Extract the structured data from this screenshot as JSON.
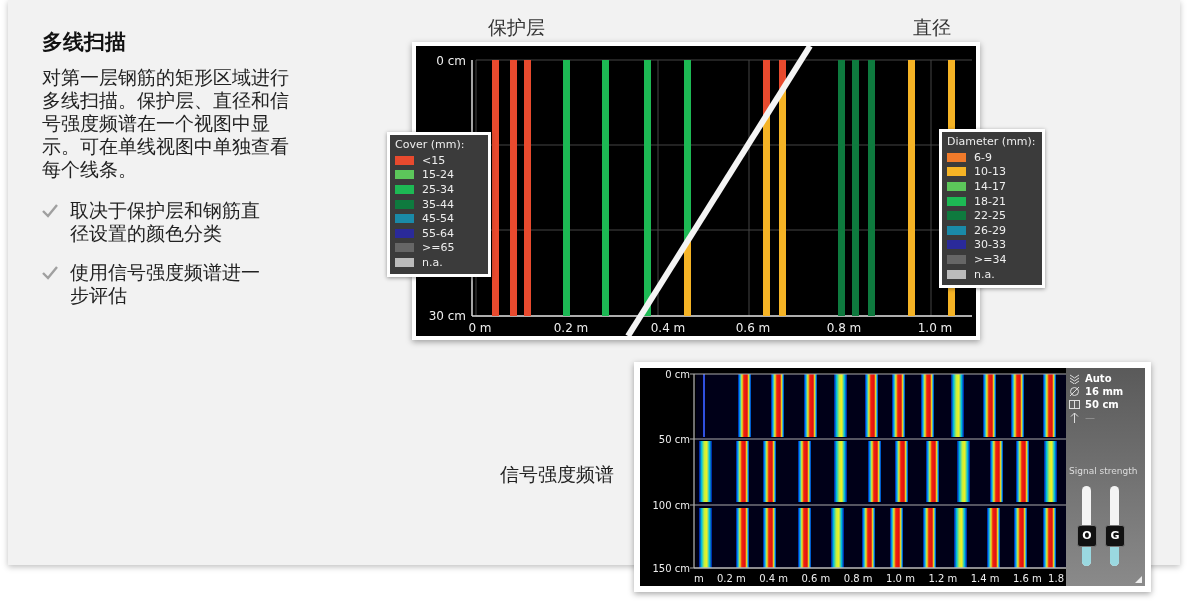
{
  "heading": "多线扫描",
  "description": "对第一层钢筋的矩形区域进行多线扫描。保护层、直径和信号强度频谱在一个视图中显示。可在单线视图中单独查看每个线条。",
  "features": [
    "取决于保护层和钢筋直径设置的颜色分类",
    "使用信号强度频谱进一步评估"
  ],
  "scan_view": {
    "left_label": "保护层",
    "right_label": "直径",
    "y_ticks": [
      "0 cm",
      "30 cm"
    ],
    "x_ticks": [
      "0 m",
      "0.2 m",
      "0.4 m",
      "0.6 m",
      "0.8 m",
      "1.0 m"
    ],
    "cover_legend": {
      "title": "Cover (mm):",
      "items": [
        {
          "label": "<15",
          "color": "#e84a2e"
        },
        {
          "label": "15-24",
          "color": "#5cc65a"
        },
        {
          "label": "25-34",
          "color": "#1db954"
        },
        {
          "label": "35-44",
          "color": "#0e7a3e"
        },
        {
          "label": "45-54",
          "color": "#1a8aa8"
        },
        {
          "label": "55-64",
          "color": "#2a2a9a"
        },
        {
          "label": ">=65",
          "color": "#666666"
        },
        {
          "label": "n.a.",
          "color": "#bbbbbb"
        }
      ]
    },
    "diameter_legend": {
      "title": "Diameter (mm):",
      "items": [
        {
          "label": "6-9",
          "color": "#f07a2a"
        },
        {
          "label": "10-13",
          "color": "#f5b325"
        },
        {
          "label": "14-17",
          "color": "#5cc65a"
        },
        {
          "label": "18-21",
          "color": "#1db954"
        },
        {
          "label": "22-25",
          "color": "#0e7a3e"
        },
        {
          "label": "26-29",
          "color": "#1a8aa8"
        },
        {
          "label": "30-33",
          "color": "#2a2a9a"
        },
        {
          "label": ">=34",
          "color": "#666666"
        },
        {
          "label": "n.a.",
          "color": "#bbbbbb"
        }
      ]
    }
  },
  "spectrum_view": {
    "label": "信号强度频谱",
    "y_ticks": [
      "0 cm",
      "50 cm",
      "100 cm",
      "150 cm"
    ],
    "x_ticks": [
      "m",
      "0.2 m",
      "0.4 m",
      "0.6 m",
      "0.8 m",
      "1.0 m",
      "1.2 m",
      "1.4 m",
      "1.6 m",
      "1.8"
    ],
    "settings": [
      {
        "kind": "depth",
        "value": "Auto"
      },
      {
        "kind": "diameter",
        "value": "16 mm"
      },
      {
        "kind": "spacing",
        "value": "50 cm"
      },
      {
        "kind": "direction",
        "value": "—"
      }
    ],
    "signal_title": "Signal strength",
    "sliders": [
      {
        "label": "O",
        "level": 0.38
      },
      {
        "label": "G",
        "level": 0.38
      }
    ]
  }
}
